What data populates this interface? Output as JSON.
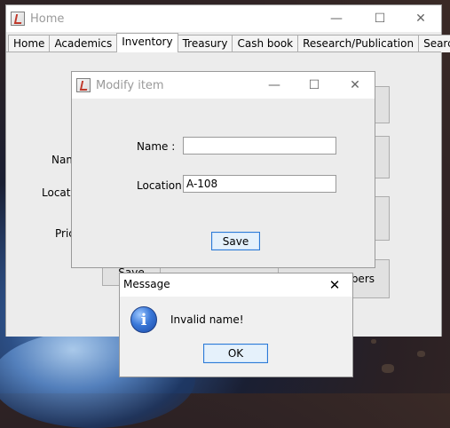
{
  "home": {
    "title": "Home",
    "tabs": [
      {
        "label": "Home"
      },
      {
        "label": "Academics"
      },
      {
        "label": "Inventory"
      },
      {
        "label": "Treasury"
      },
      {
        "label": "Cash book"
      },
      {
        "label": "Research/Publication"
      },
      {
        "label": "Search"
      }
    ],
    "active_tab": "Inventory",
    "labels": {
      "name": "Name",
      "location": "Location",
      "price": "Price"
    },
    "buttons": {
      "save": "Save",
      "numbers": "mbers"
    }
  },
  "modify": {
    "title": "Modify item",
    "name_label": "Name :",
    "name_value": "",
    "location_label": "Location :",
    "location_value": "A-108",
    "save_label": "Save"
  },
  "message": {
    "title": "Message",
    "text": "Invalid name!",
    "ok_label": "OK",
    "icon": "info-icon"
  },
  "window_controls": {
    "minimize": "—",
    "maximize": "☐",
    "close": "✕"
  }
}
